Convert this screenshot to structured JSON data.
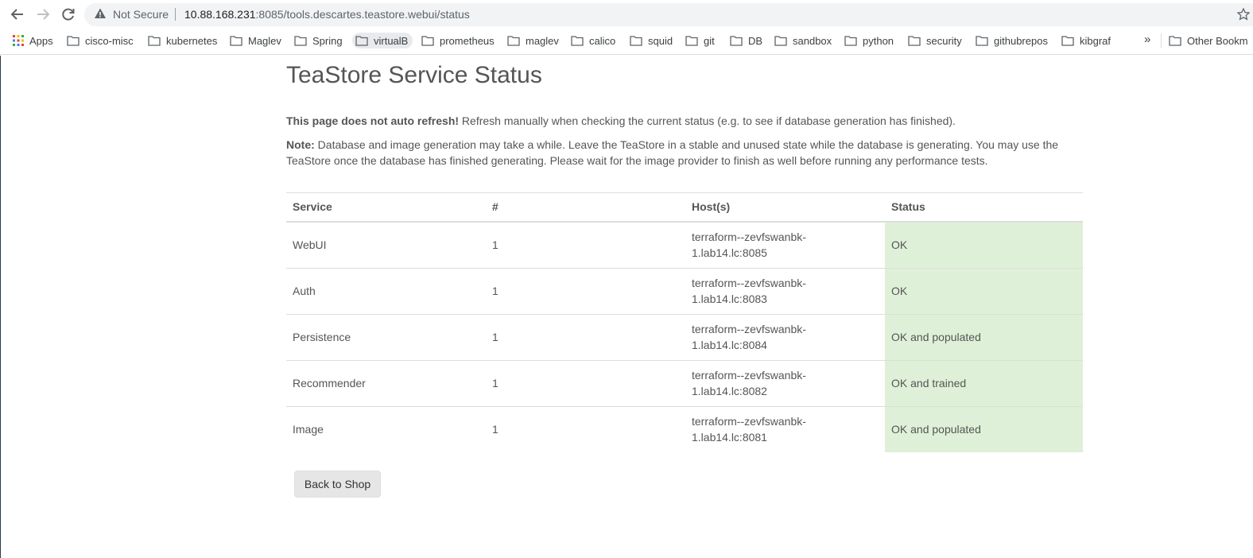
{
  "browser": {
    "security_label": "Not Secure",
    "url_host": "10.88.168.231",
    "url_rest": ":8085/tools.descartes.teastore.webui/status"
  },
  "bookmarks": {
    "apps_label": "Apps",
    "items": [
      "cisco-misc",
      "kubernetes",
      "Maglev",
      "Spring",
      "virtualB",
      "prometheus",
      "maglev",
      "calico",
      "squid",
      "git",
      "DB",
      "sandbox",
      "python",
      "security",
      "githubrepos",
      "kibgraf"
    ],
    "more_label": "»",
    "other_label": "Other Bookm"
  },
  "page": {
    "title": "TeaStore Service Status",
    "refresh_bold": "This page does not auto refresh!",
    "refresh_text": " Refresh manually when checking the current status (e.g. to see if database generation has finished).",
    "note_bold": "Note:",
    "note_text": " Database and image generation may take a while. Leave the TeaStore in a stable and unused state while the database is generating. You may use the TeaStore once the database has finished generating. Please wait for the image provider to finish as well before running any performance tests.",
    "back_button": "Back to Shop"
  },
  "table": {
    "headers": [
      "Service",
      "#",
      "Host(s)",
      "Status"
    ],
    "rows": [
      {
        "service": "WebUI",
        "count": "1",
        "host_line1": "terraform--zevfswanbk-",
        "host_line2": "1.lab14.lc:8085",
        "status": "OK"
      },
      {
        "service": "Auth",
        "count": "1",
        "host_line1": "terraform--zevfswanbk-",
        "host_line2": "1.lab14.lc:8083",
        "status": "OK"
      },
      {
        "service": "Persistence",
        "count": "1",
        "host_line1": "terraform--zevfswanbk-",
        "host_line2": "1.lab14.lc:8084",
        "status": "OK and populated"
      },
      {
        "service": "Recommender",
        "count": "1",
        "host_line1": "terraform--zevfswanbk-",
        "host_line2": "1.lab14.lc:8082",
        "status": "OK and trained"
      },
      {
        "service": "Image",
        "count": "1",
        "host_line1": "terraform--zevfswanbk-",
        "host_line2": "1.lab14.lc:8081",
        "status": "OK and populated"
      }
    ]
  },
  "colors": {
    "status_ok_bg": "#dff0d8",
    "text": "#555555"
  }
}
